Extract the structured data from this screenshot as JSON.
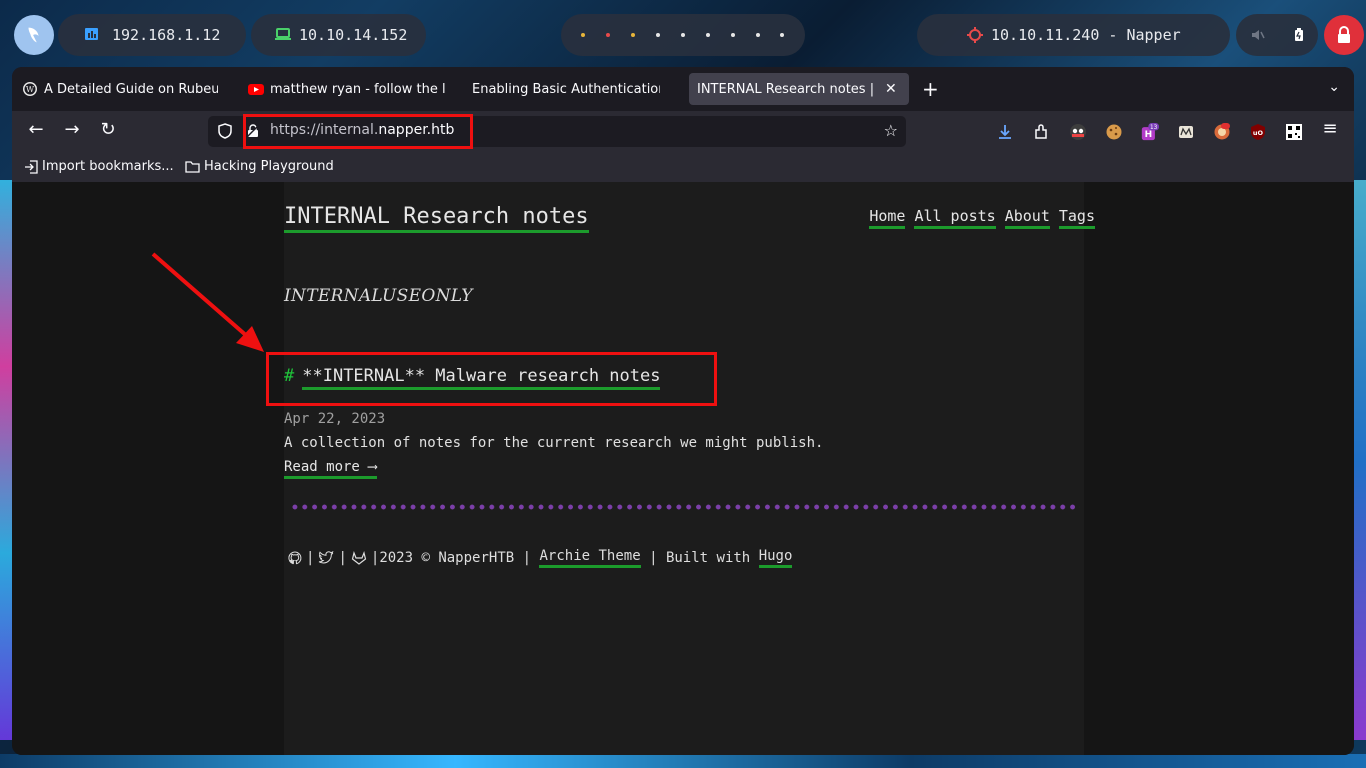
{
  "panel": {
    "local_ip": "192.168.1.12",
    "vpn_ip": "10.10.14.152",
    "target": "10.10.11.240 - Napper",
    "workspace_dot_colors": [
      "#e7b53a",
      "#e84a4a",
      "#e7b53a",
      "#e6e6e6",
      "#e6e6e6",
      "#e6e6e6",
      "#e6e6e6",
      "#e6e6e6",
      "#e6e6e6"
    ]
  },
  "browser": {
    "tabs": [
      {
        "label": "A Detailed Guide on Rubeus",
        "icon": "wordpress-icon"
      },
      {
        "label": "matthew ryan - follow the l",
        "icon": "youtube-icon"
      },
      {
        "label": "Enabling Basic Authentication",
        "icon": "none"
      },
      {
        "label": "INTERNAL Research notes | Hu",
        "icon": "none",
        "active": true
      }
    ],
    "url_prefix": "https://internal.",
    "url_domain": "napper.htb",
    "extension_badge": "13",
    "bookmarks": [
      "Import bookmarks...",
      "Hacking Playground"
    ]
  },
  "site": {
    "title": "INTERNAL Research notes",
    "menu": [
      "Home",
      "All posts",
      "About",
      "Tags"
    ],
    "subtitle": "INTERNALUSEONLY",
    "post": {
      "hash": "#",
      "title": "**INTERNAL** Malware research notes",
      "date": "Apr 22, 2023",
      "summary": "A collection of notes for the current research we might publish.",
      "read_more": "Read more ⟶"
    },
    "footer": {
      "sep": "|",
      "copyright": "2023 © NapperHTB",
      "theme_link": "Archie Theme",
      "built_with": "Built with",
      "hugo_link": "Hugo"
    }
  },
  "annotations": {
    "color": "#ee1010"
  }
}
